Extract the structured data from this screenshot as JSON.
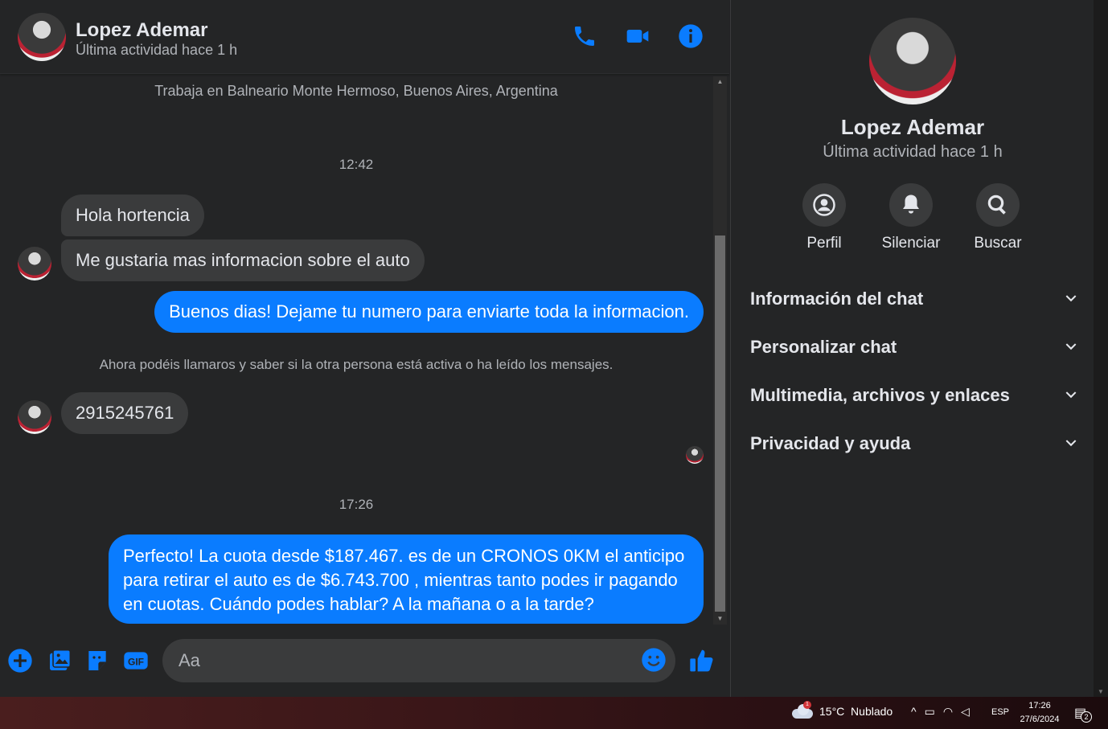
{
  "contact": {
    "name": "Lopez Ademar",
    "status": "Última actividad hace 1 h"
  },
  "header_icons": [
    "phone-icon",
    "video-call-icon",
    "info-icon"
  ],
  "conversation": {
    "work_info": "Trabaja en Balneario Monte Hermoso, Buenos Aires, Argentina",
    "time_1": "12:42",
    "msg_in_1": "Hola hortencia",
    "msg_in_2": "Me gustaria mas informacion sobre el auto",
    "msg_out_1": "Buenos dias! Dejame tu numero para enviarte toda la informacion.",
    "system_notice": "Ahora podéis llamaros y saber si la otra persona está activa o ha leído los mensajes.",
    "msg_in_3": "2915245761",
    "time_2": "17:26",
    "msg_out_2": "Perfecto! La cuota desde $187.467. es de un CRONOS 0KM el anticipo para retirar el auto es de $6.743.700 , mientras tanto podes ir pagando en cuotas. Cuándo podes hablar? A la mañana o a la tarde?"
  },
  "composer": {
    "placeholder": "Aa",
    "gif_label": "GIF",
    "icons": [
      "plus-icon",
      "photo-icon",
      "sticker-icon",
      "gif-icon",
      "emoji-icon",
      "like-icon"
    ]
  },
  "side_panel": {
    "name": "Lopez Ademar",
    "status": "Última actividad hace 1 h",
    "actions": [
      {
        "label": "Perfil",
        "icon": "profile-icon"
      },
      {
        "label": "Silenciar",
        "icon": "bell-icon"
      },
      {
        "label": "Buscar",
        "icon": "search-icon"
      }
    ],
    "sections": [
      {
        "title": "Información del chat"
      },
      {
        "title": "Personalizar chat"
      },
      {
        "title": "Multimedia, archivos y enlaces"
      },
      {
        "title": "Privacidad y ayuda"
      }
    ]
  },
  "taskbar": {
    "weather_badge": "1",
    "weather": "15°C  Nublado",
    "tray_chevron": "^",
    "language": "ESP",
    "time": "17:26",
    "date": "27/6/2024",
    "notification_count": "2"
  },
  "colors": {
    "accent": "#0a7cff",
    "background": "#242526",
    "bubble_in": "#3a3b3c",
    "text_primary": "#e4e6eb",
    "text_secondary": "#b0b3b8"
  }
}
